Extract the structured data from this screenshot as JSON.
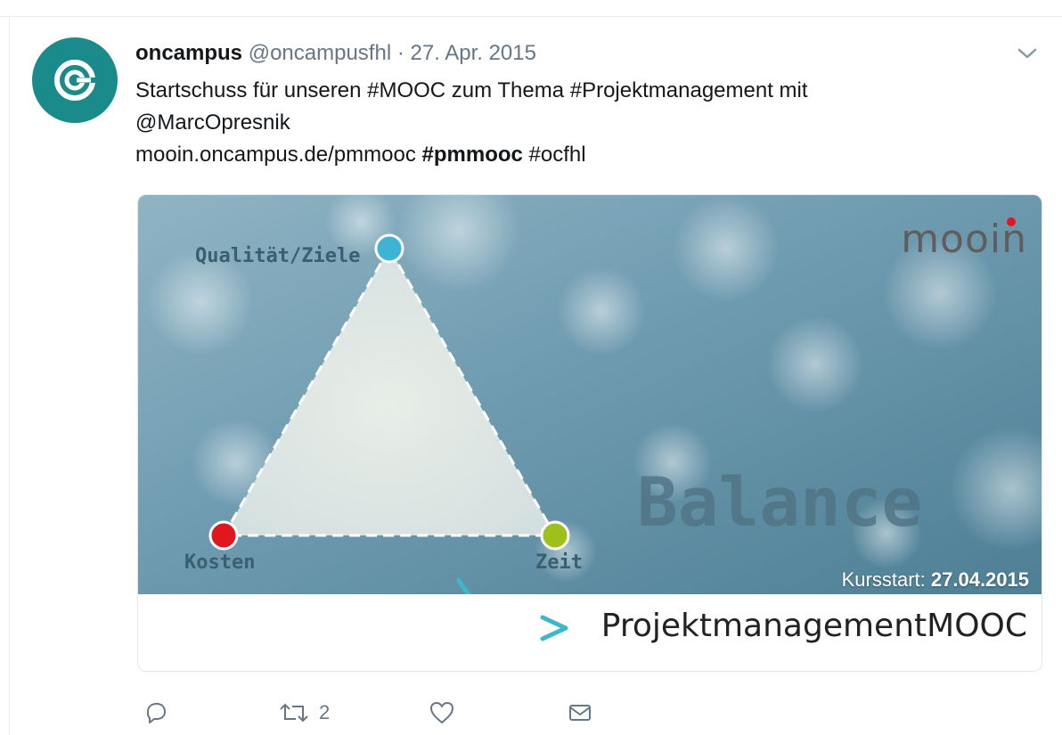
{
  "tweet": {
    "name": "oncampus",
    "handle": "@oncampusfhl",
    "separator": "·",
    "date": "27. Apr. 2015",
    "text_line1": "Startschuss für unseren #MOOC zum Thema #Projektmanagement mit",
    "text_line2": "@MarcOpresnik",
    "text_line3_link": "mooin.oncampus.de/pmmooc",
    "text_line3_tag_bold": "#pmmooc",
    "text_line3_tag": "#ocfhl"
  },
  "card": {
    "corner_left": "Qualität/Ziele",
    "corner_bottom_left": "Kosten",
    "corner_bottom_right": "Zeit",
    "brand_logo": "mooin",
    "big_word": "Balance",
    "kursstart_label": "Kursstart:",
    "kursstart_date": "27.04.2015",
    "title": "ProjektmanagementMOOC"
  },
  "actions": {
    "reply": {
      "icon": "reply-icon",
      "count": ""
    },
    "retweet": {
      "icon": "retweet-icon",
      "count": "2"
    },
    "like": {
      "icon": "heart-icon",
      "count": ""
    },
    "dm": {
      "icon": "envelope-icon",
      "count": ""
    }
  },
  "colors": {
    "avatar": "#1a8a8a",
    "muted": "#657786",
    "node_top": "#3fb3d6",
    "node_left": "#e0171f",
    "node_right": "#9dc01a",
    "arrow": "#3fb6c9"
  }
}
